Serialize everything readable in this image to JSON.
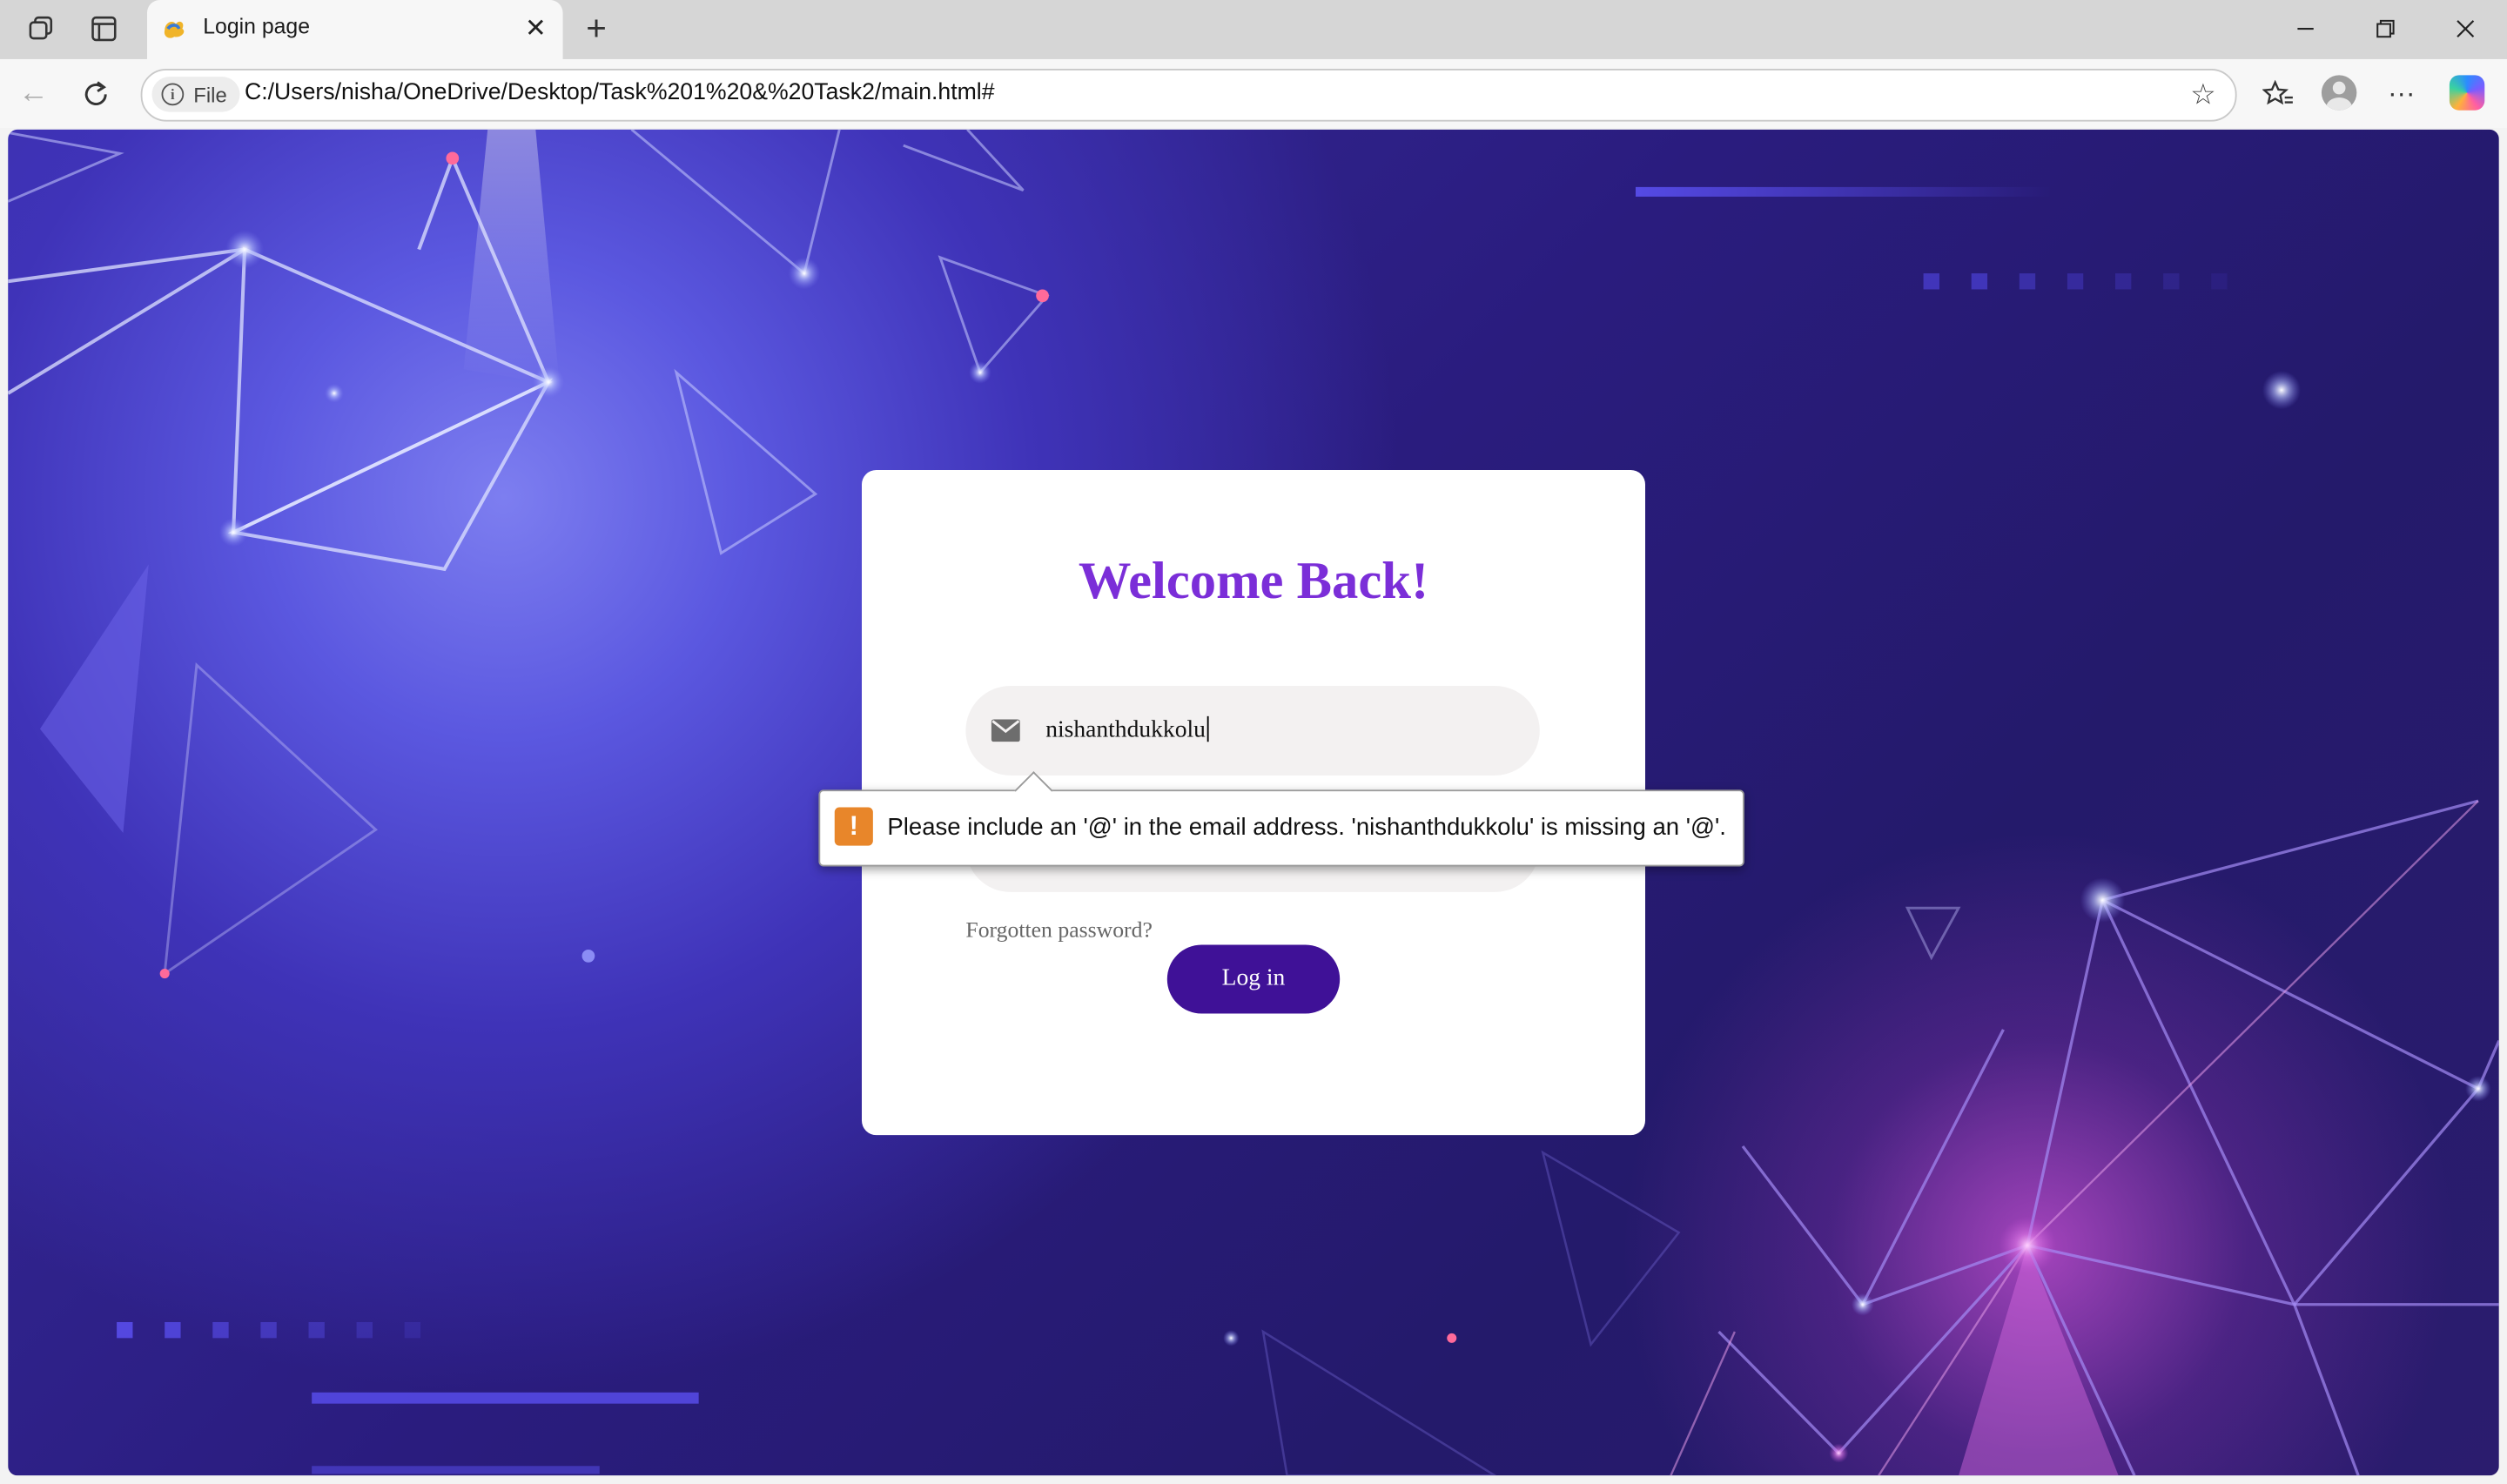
{
  "browser": {
    "tab": {
      "title": "Login page"
    },
    "address_bar": {
      "site_info_label": "File",
      "url": "C:/Users/nisha/OneDrive/Desktop/Task%201%20&%20Task2/main.html#"
    }
  },
  "page": {
    "heading": "Welcome Back!",
    "email_input": {
      "value": "nishanthdukkolu"
    },
    "password_input": {
      "value": ""
    },
    "forgot_link": "Forgotten password?",
    "login_button": "Log in",
    "validation_message": "Please include an '@' in the email address. 'nishanthdukkolu' is missing an '@'."
  },
  "colors": {
    "heading": "#7b2ed8",
    "login_button": "#3f1197",
    "warning_icon": "#e8862a",
    "background_dark": "#241a6b",
    "background_light": "#7d7ef0"
  },
  "icons": [
    "workspaces-icon",
    "tab-actions-icon",
    "close-tab-icon",
    "new-tab-icon",
    "minimize-icon",
    "restore-icon",
    "close-window-icon",
    "back-icon",
    "refresh-icon",
    "info-icon",
    "favorite-star-icon",
    "favorites-icon",
    "profile-icon",
    "more-icon",
    "copilot-icon",
    "mail-icon",
    "warning-icon"
  ]
}
